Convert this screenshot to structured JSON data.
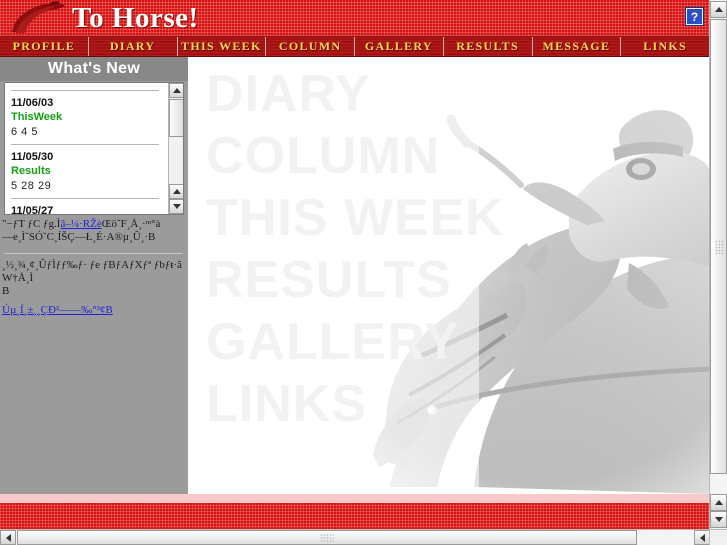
{
  "banner": {
    "title": "To Horse!",
    "logo_icon": "horse-head-icon",
    "help_badge_label": "?"
  },
  "nav": {
    "items": [
      {
        "label": "PROFILE"
      },
      {
        "label": "DIARY"
      },
      {
        "label": "THIS WEEK"
      },
      {
        "label": "COLUMN"
      },
      {
        "label": "GALLERY"
      },
      {
        "label": "RESULTS"
      },
      {
        "label": "MESSAGE"
      },
      {
        "label": "LINKS"
      }
    ]
  },
  "sidebar": {
    "whats_new_title": "What's New",
    "news_items": [
      {
        "date": "11/06/03",
        "category": "ThisWeek",
        "detail": "6 4  5"
      },
      {
        "date": "11/05/30",
        "category": "Results",
        "detail": "5 28  29"
      },
      {
        "date": "11/05/27",
        "category": "",
        "detail": ""
      }
    ],
    "text_block": {
      "line1_pre": "\"−ƒT ƒC ƒg.Ì",
      "line1_link": "â–¼·RŽè",
      "line1_post": "ŒöˇF¸Å¸·ᵐ°à",
      "line2": "—e¸ÌˇSÓˇC¸ÍŠÇ—Ł¸É·A®µ¸Û¸·B",
      "line3": "¸½¸¾¸¢¸ÛƒÌƒƒ‰ƒ· ƒe ƒBƒAƒXƒª ƒbƒŧ·ãW†Å¸Ì",
      "line4": "B",
      "line5_link": "Úµ¸Í¸±¸¸ÇÐ²——‰°³¢B"
    }
  },
  "main": {
    "ghost_words": [
      "DIARY",
      "COLUMN",
      "THIS WEEK",
      "RESULTS",
      "GALLERY",
      "LINKS"
    ],
    "photo_alt": "racehorse-and-jockey-photo"
  },
  "colors": {
    "banner_red": "#d81111",
    "nav_red": "#a51010",
    "nav_text_gold": "#ffd84d",
    "sidebar_gray": "#9b9b9b",
    "news_category_green": "#14a014",
    "link_blue": "#2222dd",
    "footer_pink": "#fbc9c9",
    "ghost_word_gray": "#f2f2f2"
  }
}
